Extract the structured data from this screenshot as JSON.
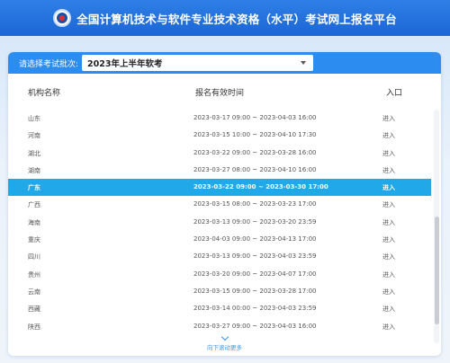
{
  "header": {
    "title": "全国计算机技术与软件专业技术资格（水平）考试网上报名平台"
  },
  "selector": {
    "label": "请选择考试批次:",
    "value": "2023年上半年软考"
  },
  "table": {
    "columns": [
      "机构名称",
      "报名有效时间",
      "入口"
    ],
    "rows": [
      {
        "org": "山东",
        "time": "2023-03-17 09:00 ~ 2023-04-03 16:00",
        "entry": "进入"
      },
      {
        "org": "河南",
        "time": "2023-03-15 10:00 ~ 2023-04-10 17:30",
        "entry": "进入"
      },
      {
        "org": "湖北",
        "time": "2023-03-22 09:00 ~ 2023-03-28 16:00",
        "entry": "进入"
      },
      {
        "org": "湖南",
        "time": "2023-03-27 08:00 ~ 2023-04-10 16:00",
        "entry": "进入"
      },
      {
        "org": "广东",
        "time": "2023-03-22 09:00 ~ 2023-03-30 17:00",
        "entry": "进入"
      },
      {
        "org": "广西",
        "time": "2023-03-15 08:00 ~ 2023-03-23 17:00",
        "entry": "进入"
      },
      {
        "org": "海南",
        "time": "2023-03-13 09:00 ~ 2023-03-20 23:59",
        "entry": "进入"
      },
      {
        "org": "重庆",
        "time": "2023-04-03 09:00 ~ 2023-04-13 17:00",
        "entry": "进入"
      },
      {
        "org": "四川",
        "time": "2023-03-13 09:00 ~ 2023-04-03 23:59",
        "entry": "进入"
      },
      {
        "org": "贵州",
        "time": "2023-03-20 09:00 ~ 2023-04-07 17:00",
        "entry": "进入"
      },
      {
        "org": "云南",
        "time": "2023-03-15 09:00 ~ 2023-03-28 17:00",
        "entry": "进入"
      },
      {
        "org": "西藏",
        "time": "2023-03-14 00:00 ~ 2023-04-03 23:59",
        "entry": "进入"
      },
      {
        "org": "陕西",
        "time": "2023-03-27 09:00 ~ 2023-04-03 16:00",
        "entry": "进入"
      }
    ],
    "active_row": "广东"
  },
  "footer": {
    "scroll_hint": "向下滚动更多"
  },
  "colors": {
    "brand": "#1b66d6",
    "selector_bar": "#2d8cf0",
    "active_row": "#20a8e8",
    "hint": "#3a96e8"
  }
}
